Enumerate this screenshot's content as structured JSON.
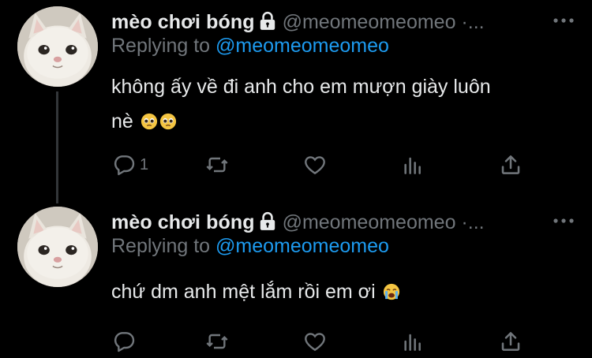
{
  "tweets": [
    {
      "author_name": "mèo chơi bóng",
      "handle": "@meomeomeomeo ·...",
      "replying_prefix": "Replying to ",
      "replying_handle": "@meomeomeomeo",
      "body_line1": "không ấy về đi anh cho em mượn giày luôn",
      "body_line2": "nè",
      "reply_count": "1",
      "icons": [
        "avatar-cat",
        "lock-icon",
        "more-icon",
        "pleading-face-emoji",
        "pleading-face-emoji",
        "reply-icon",
        "retweet-icon",
        "like-icon",
        "views-icon",
        "share-icon"
      ]
    },
    {
      "author_name": "mèo chơi bóng",
      "handle": "@meomeomeomeo ·...",
      "replying_prefix": "Replying to ",
      "replying_handle": "@meomeomeomeo",
      "body_line1": "chứ dm anh mệt lắm rồi em ơi",
      "reply_count": "",
      "icons": [
        "avatar-cat",
        "lock-icon",
        "more-icon",
        "crying-face-emoji",
        "reply-icon",
        "retweet-icon",
        "like-icon",
        "views-icon",
        "share-icon"
      ]
    }
  ],
  "colors": {
    "background": "#000000",
    "text_primary": "#e7e9ea",
    "text_secondary": "#71767b",
    "accent": "#1d9bf0",
    "thread_line": "#333639"
  }
}
